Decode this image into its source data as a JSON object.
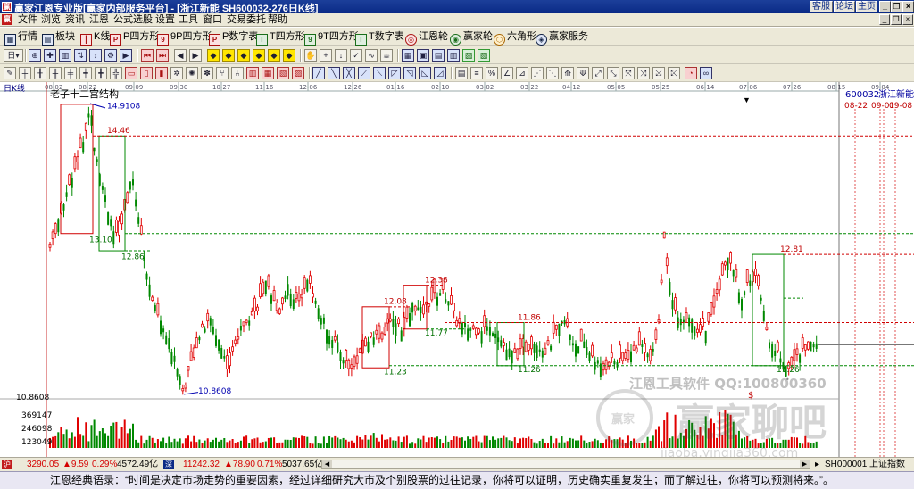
{
  "window": {
    "title": "赢家江恩专业版[赢家内部服务平台] - [浙江新能  SH600032-276日K线]",
    "links": [
      "客服",
      "论坛",
      "主页"
    ],
    "controls": [
      "minimize",
      "restore",
      "close"
    ]
  },
  "menu": {
    "items": [
      "文件",
      "浏览",
      "资讯",
      "江恩",
      "公式选股",
      "设置",
      "工具",
      "窗口",
      "交易委托",
      "帮助"
    ]
  },
  "toolbar1": {
    "items": [
      {
        "label": "行情",
        "icon": "grid-icon"
      },
      {
        "label": "板块",
        "icon": "blocks-icon"
      },
      {
        "label": "K线",
        "icon": "kline-icon"
      },
      {
        "label": "P四方形",
        "icon": "p-square-icon"
      },
      {
        "label": "9P四方形",
        "icon": "9p-square-icon"
      },
      {
        "label": "P数字表",
        "icon": "p-table-icon"
      },
      {
        "label": "T四方形",
        "icon": "t-square-icon"
      },
      {
        "label": "9T四方形",
        "icon": "9t-square-icon"
      },
      {
        "label": "T数字表",
        "icon": "t-table-icon"
      },
      {
        "label": "江恩轮",
        "icon": "gann-wheel-icon"
      },
      {
        "label": "赢家轮",
        "icon": "winner-wheel-icon"
      },
      {
        "label": "六角形",
        "icon": "hexagon-icon"
      },
      {
        "label": "赢家服务",
        "icon": "service-icon"
      }
    ]
  },
  "toolbar2": {
    "period_label": "日"
  },
  "chart": {
    "period_label": "日K线",
    "indicator_label": "老子十二宫结构",
    "stock_code": "600032",
    "stock_name": "浙江新能",
    "right_dates": [
      "08-22",
      "09-01",
      "09-08"
    ],
    "x_ticks": [
      "08-02",
      "08-22",
      "09-09",
      "09-30",
      "10-27",
      "11-16",
      "12-06",
      "12-26",
      "01-16",
      "02-10",
      "03-02",
      "03-22",
      "04-12",
      "05-05",
      "05-25",
      "06-14",
      "07-06",
      "07-26",
      "08-15",
      "09-04"
    ],
    "levels": [
      {
        "label": "14.9108",
        "value": 14.9108,
        "color": "#0000b0"
      },
      {
        "label": "14.46",
        "value": 14.46,
        "color": "#c00000"
      },
      {
        "label": "13.10",
        "value": 13.1,
        "color": "#007000"
      },
      {
        "label": "12.86",
        "value": 12.86,
        "color": "#007000"
      },
      {
        "label": "12.81",
        "value": 12.81,
        "color": "#c00000"
      },
      {
        "label": "12.38",
        "value": 12.38,
        "color": "#c00000"
      },
      {
        "label": "12.08",
        "value": 12.08,
        "color": "#c00000"
      },
      {
        "label": "11.86",
        "value": 11.86,
        "color": "#c00000"
      },
      {
        "label": "11.77",
        "value": 11.77,
        "color": "#007000"
      },
      {
        "label": "11.26",
        "value": 11.26,
        "color": "#007000"
      },
      {
        "label": "11.23",
        "value": 11.23,
        "color": "#007000"
      },
      {
        "label": "11.26",
        "value": 11.26,
        "color": "#007000"
      },
      {
        "label": "10.8608",
        "value": 10.8608,
        "color": "#0000b0"
      }
    ],
    "low_axis_label": "10.8608",
    "volume_ticks": [
      "369147",
      "246098",
      "123049"
    ],
    "watermark_1": "江恩工具软件 QQ:100800360",
    "watermark_2": "赢家聊吧",
    "watermark_3": "jiaoba.yingjia360.com",
    "marker": "$",
    "dot_marker": "•"
  },
  "chart_data": {
    "type": "candlestick",
    "price_range": [
      10.86,
      15.06
    ],
    "volume_range": [
      0,
      480000
    ],
    "ticks": [
      "08-02",
      "08-22",
      "09-09",
      "09-30",
      "10-27",
      "11-16",
      "12-06",
      "12-26",
      "01-16",
      "02-10",
      "03-02",
      "03-22",
      "04-12",
      "05-05",
      "05-25",
      "06-14",
      "07-06",
      "07-26",
      "08-15",
      "09-04"
    ],
    "key_prices": {
      "high": 14.9108,
      "low": 10.8608,
      "last_close": 11.32
    }
  },
  "status": {
    "sh_index": "3290.05",
    "sh_change": "▲9.59",
    "sh_pct": "0.29%",
    "sh_amount": "4572.49亿",
    "sz_index": "11242.32",
    "sz_change": "▲78.90",
    "sz_pct": "0.71%",
    "sz_amount": "5037.65亿",
    "right_label": "SH000001 上证指数"
  },
  "quote": "江恩经典语录：“时间是决定市场走势的重要因素，经过详细研究大市及个别股票的过往记录，你将可以证明，历史确实重复发生；而了解过往，你将可以预测将来。”。"
}
